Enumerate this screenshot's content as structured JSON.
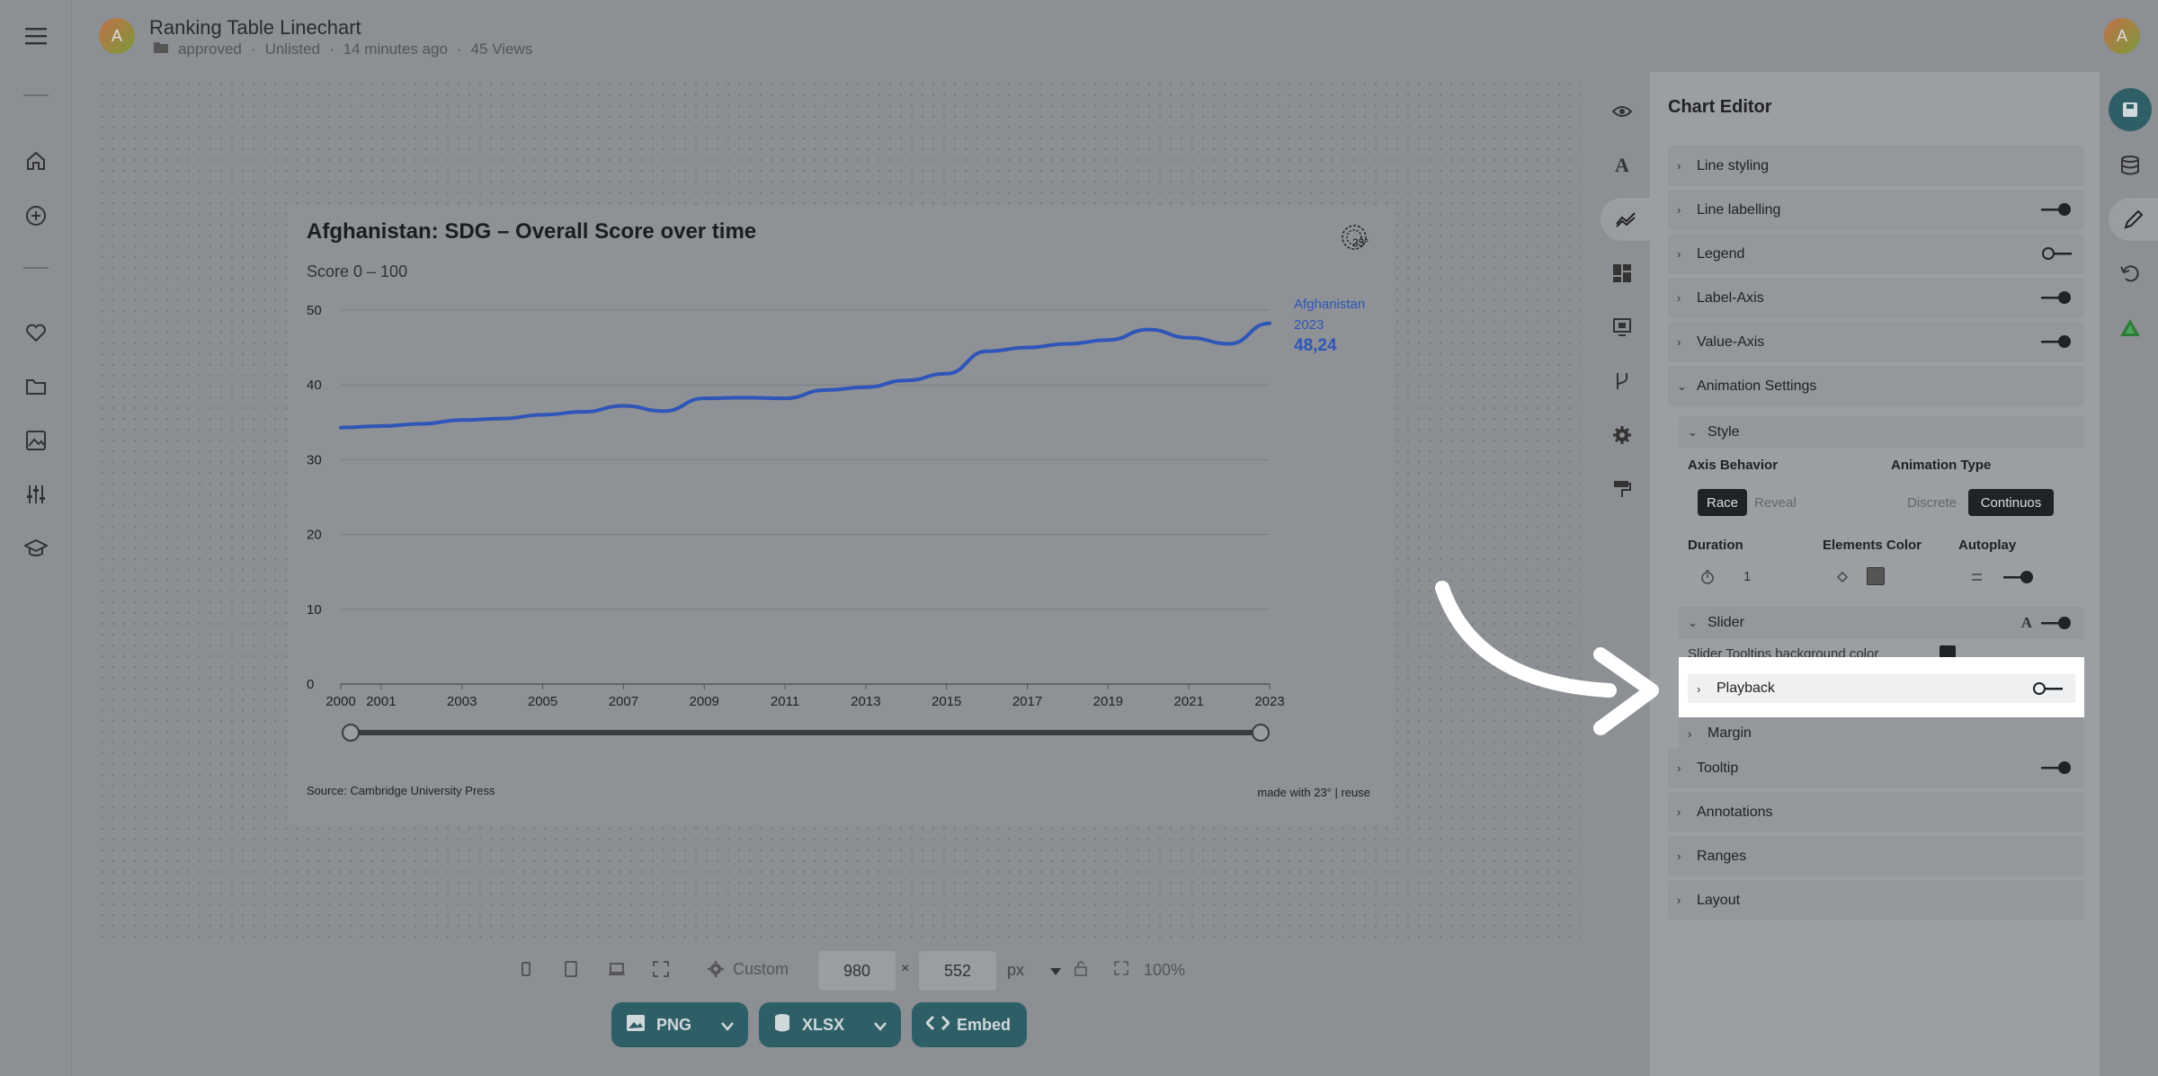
{
  "header": {
    "avatar_letter": "A",
    "title": "Ranking Table Linechart",
    "folder": "approved",
    "visibility": "Unlisted",
    "updated": "14 minutes ago",
    "views": "45 Views",
    "user_avatar_letter": "A"
  },
  "chart": {
    "title": "Afghanistan: SDG – Overall Score over time",
    "subtitle": "Score 0 – 100",
    "source": "Source: Cambridge University Press",
    "made_with": "made with 23° | reuse",
    "end_label_name": "Afghanistan",
    "end_label_year": "2023",
    "end_label_value": "48,24"
  },
  "chart_data": {
    "type": "line",
    "title": "Afghanistan: SDG – Overall Score over time",
    "ylabel": "Score 0 – 100",
    "ylim": [
      0,
      50
    ],
    "yticks": [
      0,
      10,
      20,
      30,
      40,
      50
    ],
    "xticks": [
      2000,
      2001,
      2003,
      2005,
      2007,
      2009,
      2011,
      2013,
      2015,
      2017,
      2019,
      2021,
      2023
    ],
    "grid": true,
    "series": [
      {
        "name": "Afghanistan",
        "color": "#2f55b8",
        "x": [
          2000,
          2001,
          2002,
          2003,
          2004,
          2005,
          2006,
          2007,
          2008,
          2009,
          2010,
          2011,
          2012,
          2013,
          2014,
          2015,
          2016,
          2017,
          2018,
          2019,
          2020,
          2021,
          2022,
          2023
        ],
        "y": [
          34.3,
          34.5,
          34.8,
          35.3,
          35.5,
          36.0,
          36.4,
          37.2,
          36.5,
          38.2,
          38.3,
          38.2,
          39.3,
          39.7,
          40.6,
          41.5,
          44.5,
          45.0,
          45.5,
          46.0,
          47.4,
          46.3,
          45.5,
          48.24
        ]
      }
    ]
  },
  "editor": {
    "title": "Chart Editor",
    "sections": {
      "line_styling": "Line styling",
      "line_labelling": "Line labelling",
      "legend": "Legend",
      "label_axis": "Label-Axis",
      "value_axis": "Value-Axis",
      "animation_settings": "Animation Settings",
      "style": "Style",
      "axis_behavior": "Axis Behavior",
      "race": "Race",
      "reveal": "Reveal",
      "animation_type": "Animation Type",
      "discrete": "Discrete",
      "continuos": "Continuos",
      "duration": "Duration",
      "duration_value": "1",
      "elements_color": "Elements Color",
      "autoplay": "Autoplay",
      "slider": "Slider",
      "slider_tooltips_bg": "Slider Tooltips background color",
      "playback": "Playback",
      "margin": "Margin",
      "tooltip": "Tooltip",
      "annotations": "Annotations",
      "ranges": "Ranges",
      "layout": "Layout"
    },
    "toggles": {
      "line_labelling": true,
      "legend": false,
      "label_axis": true,
      "value_axis": true,
      "autoplay": true,
      "slider": true,
      "playback": false,
      "tooltip": true
    }
  },
  "bottom": {
    "custom": "Custom",
    "width": "980",
    "times": "×",
    "height": "552",
    "unit": "px",
    "zoom": "100%",
    "png": "PNG",
    "xlsx": "XLSX",
    "embed": "Embed"
  },
  "colors": {
    "accent": "#2f5f66",
    "line": "#2f55b8",
    "highlight": "#ffffff"
  }
}
